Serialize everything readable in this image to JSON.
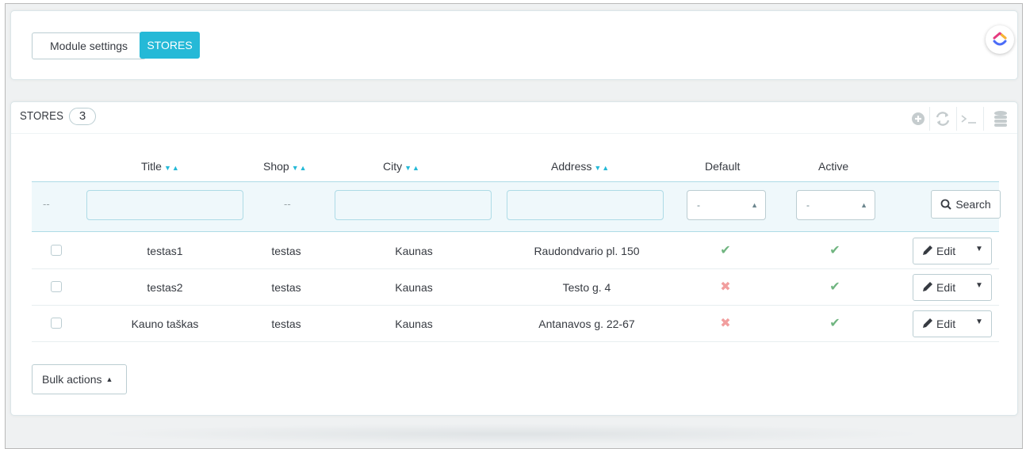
{
  "tabs": {
    "module_settings": "Module settings",
    "stores": "STORES"
  },
  "colors": {
    "accent": "#25b9d7",
    "success": "#70b580",
    "danger": "#f19e9e"
  },
  "list": {
    "title": "STORES",
    "count": "3",
    "toolbar_icons": [
      "add-icon",
      "refresh-icon",
      "sql-query-icon",
      "export-database-icon"
    ]
  },
  "columns": {
    "title": "Title",
    "shop": "Shop",
    "city": "City",
    "address": "Address",
    "default": "Default",
    "active": "Active"
  },
  "filters": {
    "id_placeholder": "--",
    "shop_placeholder": "--",
    "default_value": "-",
    "active_value": "-",
    "search_label": "Search"
  },
  "rows": [
    {
      "title": "testas1",
      "shop": "testas",
      "city": "Kaunas",
      "address": "Raudondvario pl. 150",
      "default": true,
      "active": true,
      "edit_label": "Edit"
    },
    {
      "title": "testas2",
      "shop": "testas",
      "city": "Kaunas",
      "address": "Testo g. 4",
      "default": false,
      "active": true,
      "edit_label": "Edit"
    },
    {
      "title": "Kauno taškas",
      "shop": "testas",
      "city": "Kaunas",
      "address": "Antanavos g. 22-67",
      "default": false,
      "active": true,
      "edit_label": "Edit"
    }
  ],
  "bulk_actions": "Bulk actions"
}
